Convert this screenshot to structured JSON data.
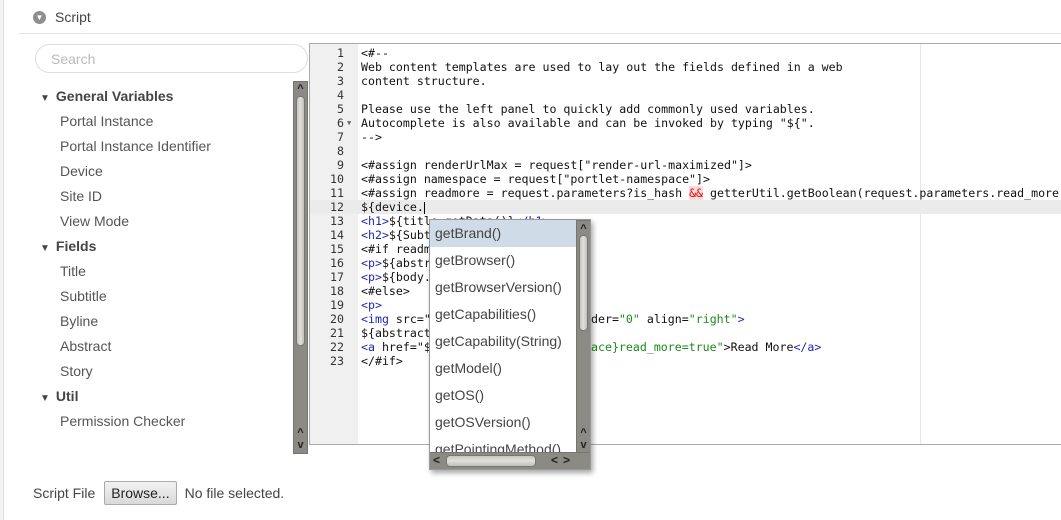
{
  "section": {
    "title": "Script",
    "icon": "chevron-down-circle-icon"
  },
  "search": {
    "placeholder": "Search"
  },
  "sidebar": {
    "groups": [
      {
        "label": "General Variables",
        "items": [
          "Portal Instance",
          "Portal Instance Identifier",
          "Device",
          "Site ID",
          "View Mode"
        ]
      },
      {
        "label": "Fields",
        "items": [
          "Title",
          "Subtitle",
          "Byline",
          "Abstract",
          "Story"
        ]
      },
      {
        "label": "Util",
        "items": [
          "Permission Checker"
        ]
      }
    ]
  },
  "editor": {
    "active_line": 12,
    "lines": [
      {
        "n": "1",
        "s": [
          [
            "<#--",
            ""
          ]
        ]
      },
      {
        "n": "2",
        "s": [
          [
            "Web content templates are used to lay out the fields defined in a web",
            ""
          ]
        ]
      },
      {
        "n": "3",
        "s": [
          [
            "content structure.",
            ""
          ]
        ]
      },
      {
        "n": "4",
        "s": []
      },
      {
        "n": "5",
        "s": [
          [
            "Please use the left panel to quickly add commonly used variables.",
            ""
          ]
        ]
      },
      {
        "n": "6",
        "fold": true,
        "s": [
          [
            "Autocomplete is also available and can be invoked by typing \"${\".",
            ""
          ]
        ]
      },
      {
        "n": "7",
        "s": [
          [
            "-->",
            ""
          ]
        ]
      },
      {
        "n": "8",
        "s": []
      },
      {
        "n": "9",
        "s": [
          [
            "<#assign renderUrlMax = request[\"render-url-maximized\"]>",
            ""
          ]
        ]
      },
      {
        "n": "10",
        "s": [
          [
            "<#assign namespace = request[\"portlet-namespace\"]>",
            ""
          ]
        ]
      },
      {
        "n": "11",
        "s": [
          [
            "<#assign readmore = request.parameters?is_hash ",
            ""
          ],
          [
            "&&",
            "amp"
          ],
          [
            " getterUtil.getBoolean(request.parameters.read_more",
            ""
          ]
        ]
      },
      {
        "n": "12",
        "caret": true,
        "s": [
          [
            "${device.",
            ""
          ]
        ]
      },
      {
        "n": "13",
        "s": [
          [
            "<h1>",
            "tag"
          ],
          [
            "${title.getData()}",
            ""
          ],
          [
            "</h1>",
            "tag"
          ]
        ]
      },
      {
        "n": "14",
        "s": [
          [
            "<h2>",
            "tag"
          ],
          [
            "${Subt",
            ""
          ]
        ]
      },
      {
        "n": "15",
        "s": [
          [
            "<#if readm",
            ""
          ]
        ]
      },
      {
        "n": "16",
        "s": [
          [
            "<p>",
            "tag"
          ],
          [
            "${abstr",
            ""
          ]
        ]
      },
      {
        "n": "17",
        "s": [
          [
            "<p>",
            "tag"
          ],
          [
            "${body.",
            ""
          ]
        ]
      },
      {
        "n": "18",
        "s": [
          [
            "<#else>",
            ""
          ]
        ]
      },
      {
        "n": "19",
        "s": [
          [
            "<p>",
            "tag"
          ]
        ]
      },
      {
        "n": "20",
        "s": [
          [
            "<img ",
            "tag"
          ],
          [
            "src=\"",
            ""
          ]
        ],
        "t": [
          [
            "der=",
            ""
          ],
          [
            "\"0\"",
            "str"
          ],
          [
            " align=",
            ""
          ],
          [
            "\"right\"",
            "str"
          ],
          [
            ">",
            "tag"
          ]
        ]
      },
      {
        "n": "21",
        "s": [
          [
            "${abstract",
            ""
          ]
        ]
      },
      {
        "n": "22",
        "s": [
          [
            "<a ",
            "tag"
          ],
          [
            "href=\"$",
            ""
          ]
        ],
        "t": [
          [
            "ace}read_more=true\"",
            "str"
          ],
          [
            ">",
            ""
          ],
          [
            "Read More",
            ""
          ],
          [
            "</a>",
            "tag"
          ]
        ]
      },
      {
        "n": "23",
        "s": [
          [
            "</#if>",
            ""
          ]
        ]
      }
    ]
  },
  "autocomplete": {
    "selected": 0,
    "options": [
      "getBrand()",
      "getBrowser()",
      "getBrowserVersion()",
      "getCapabilities()",
      "getCapability(String)",
      "getModel()",
      "getOS()",
      "getOSVersion()",
      "getPointingMethod()"
    ]
  },
  "file": {
    "label": "Script File",
    "button": "Browse...",
    "status": "No file selected."
  }
}
